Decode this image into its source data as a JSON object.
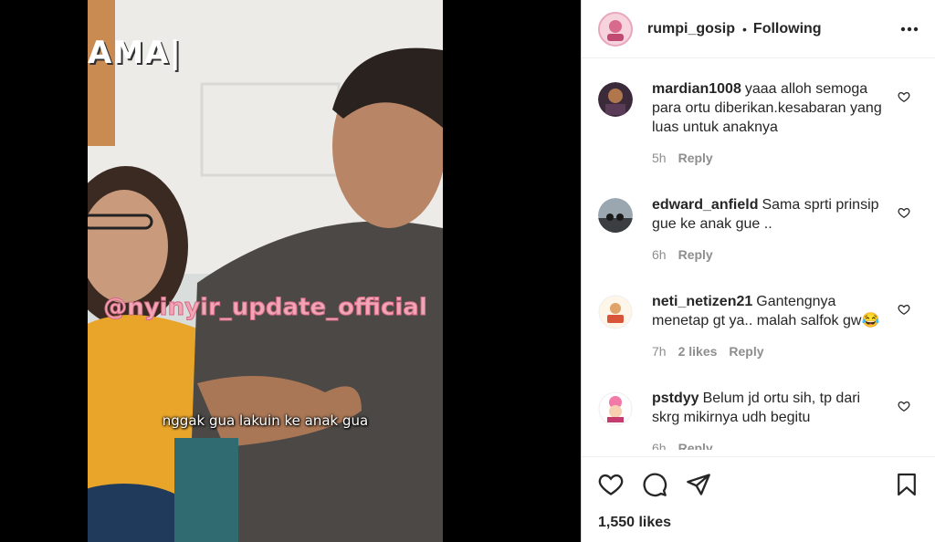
{
  "video": {
    "corner_text": "AMA|",
    "watermark": "@nyinyir_update_official",
    "subtitle": "nggak gua lakuin ke anak gua"
  },
  "header": {
    "username": "rumpi_gosip",
    "separator": "•",
    "follow_state": "Following",
    "more_icon": "more-horizontal-icon"
  },
  "comments": [
    {
      "username": "mardian1008",
      "text": "yaaa alloh semoga para ortu diberikan.kesabaran yang luas untuk anaknya",
      "time": "5h",
      "likes": "",
      "reply": "Reply"
    },
    {
      "username": "edward_anfield",
      "text": "Sama sprti prinsip gue ke anak gue ..",
      "time": "6h",
      "likes": "",
      "reply": "Reply"
    },
    {
      "username": "neti_netizen21",
      "text": "Gantengnya menetap gt ya.. malah salfok gw😂",
      "time": "7h",
      "likes": "2 likes",
      "reply": "Reply"
    },
    {
      "username": "pstdyy",
      "text": "Belum jd ortu sih, tp dari skrg mikirnya udh begitu",
      "time": "6h",
      "likes": "",
      "reply": "Reply"
    }
  ],
  "actions": {
    "like_icon": "heart-icon",
    "comment_icon": "comment-icon",
    "share_icon": "share-icon",
    "save_icon": "bookmark-icon"
  },
  "likes_count": "1,550 likes",
  "colors": {
    "text": "#262626",
    "muted": "#8e8e8e",
    "border": "#dbdbdb",
    "watermark": "#f2a6b5"
  }
}
